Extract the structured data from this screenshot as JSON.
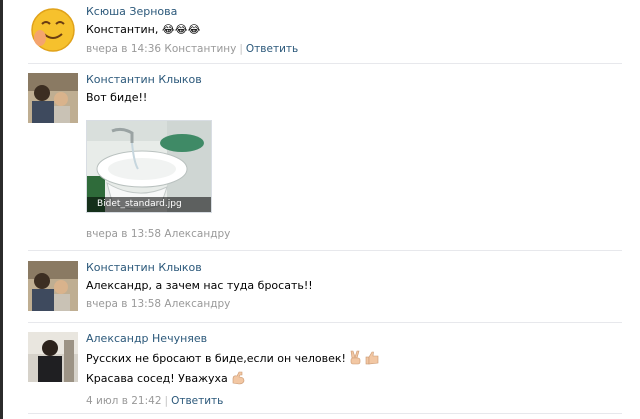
{
  "comments": [
    {
      "author": "Ксюша Зернова",
      "lines": [
        "Константин, 😂😂😂"
      ],
      "meta": {
        "time": "вчера в 14:36",
        "reply_to": "Константину",
        "action": "Ответить"
      }
    },
    {
      "author": "Константин Клыков",
      "lines": [
        "Вот биде!!"
      ],
      "attachment": {
        "caption": "Bidet_standard.jpg"
      },
      "meta": {
        "time": "вчера в 13:58",
        "reply_to": "Александру"
      }
    },
    {
      "author": "Константин Клыков",
      "lines": [
        "Александр, а зачем нас туда бросать!!"
      ],
      "meta": {
        "time": "вчера в 13:58",
        "reply_to": "Александру"
      }
    },
    {
      "author": "Александр Нечуняев",
      "lines": [
        "Русских не бросают в биде,если он человек!",
        "Красава сосед! Уважуха"
      ],
      "meta": {
        "time": "4 июл в 21:42",
        "action": "Ответить"
      }
    }
  ],
  "colors": {
    "link": "#2b587a",
    "meta": "#999999",
    "divider": "#e7e8ec"
  },
  "icons": [
    "laughing-tears-emoji",
    "victory-hand-emoji",
    "thumbs-up-emoji",
    "flexed-biceps-emoji"
  ]
}
